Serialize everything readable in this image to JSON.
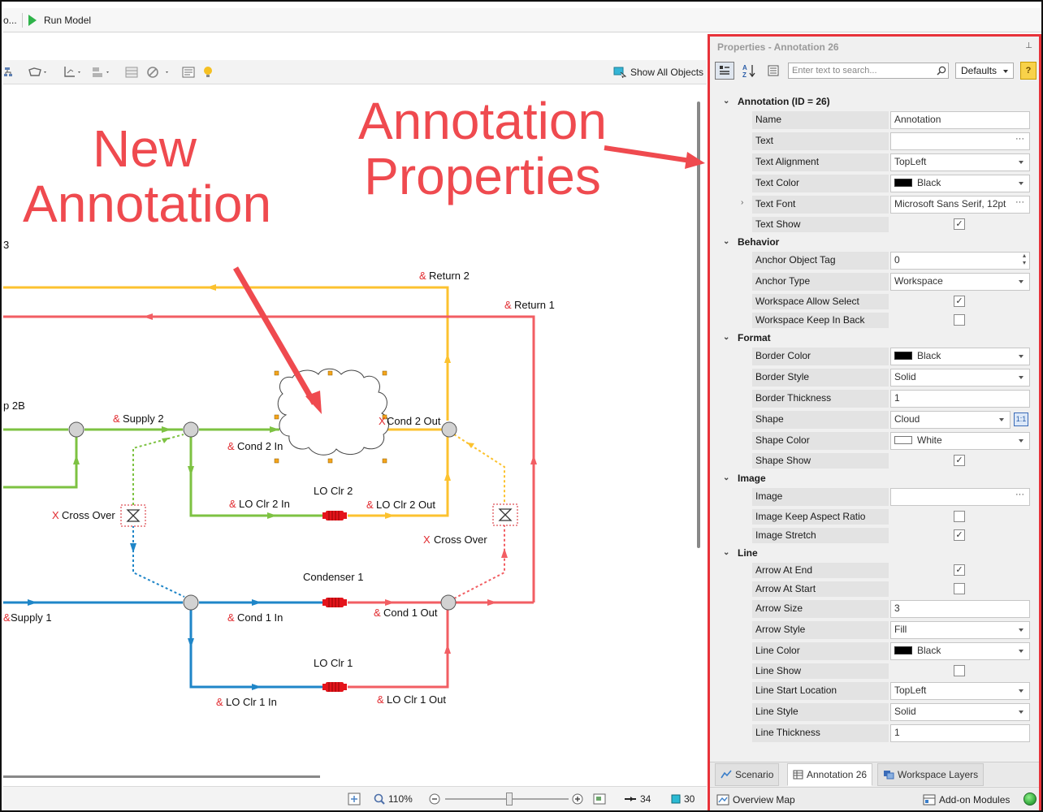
{
  "toolbar": {
    "left_cut_label": "o...",
    "run_model_label": "Run Model",
    "show_all_objects_label": "Show All Objects"
  },
  "callouts": {
    "new_annotation": "New\nAnnotation",
    "annotation_properties": "Annotation\nProperties"
  },
  "workspace_labels": {
    "truncated_3": "3",
    "p2b": "p 2B",
    "return2": "Return 2",
    "return1": "Return 1",
    "supply2": "Supply 2",
    "cond2in": "Cond 2 In",
    "cond2out": "Cond 2 Out",
    "loclr2": "LO Clr 2",
    "loclr2in": "LO Clr 2 In",
    "loclr2out": "LO Clr 2 Out",
    "crossover_left": "Cross Over",
    "crossover_right": "Cross Over",
    "condenser1": "Condenser 1",
    "supply1": "Supply 1",
    "cond1in": "Cond 1 In",
    "cond1out": "Cond 1 Out",
    "loclr1": "LO Clr 1",
    "loclr1in": "LO Clr 1 In",
    "loclr1out": "LO Clr 1 Out",
    "amp": "&",
    "x_mark": "X"
  },
  "status": {
    "zoom": "110%",
    "pipe_count": "34",
    "junction_count": "30"
  },
  "properties": {
    "title": "Properties - Annotation 26",
    "search_placeholder": "Enter text to search...",
    "defaults_label": "Defaults",
    "sections": {
      "annotation": "Annotation (ID = 26)",
      "behavior": "Behavior",
      "format": "Format",
      "image": "Image",
      "line": "Line"
    },
    "rows": {
      "name": {
        "label": "Name",
        "value": "Annotation"
      },
      "text": {
        "label": "Text",
        "value": ""
      },
      "text_alignment": {
        "label": "Text Alignment",
        "value": "TopLeft"
      },
      "text_color": {
        "label": "Text Color",
        "value": "Black"
      },
      "text_font": {
        "label": "Text Font",
        "value": "Microsoft Sans Serif, 12pt"
      },
      "text_show": {
        "label": "Text Show",
        "checked": true
      },
      "anchor_object_tag": {
        "label": "Anchor Object Tag",
        "value": "0"
      },
      "anchor_type": {
        "label": "Anchor Type",
        "value": "Workspace"
      },
      "workspace_allow_select": {
        "label": "Workspace Allow Select",
        "checked": true
      },
      "workspace_keep_in_back": {
        "label": "Workspace Keep In Back",
        "checked": false
      },
      "border_color": {
        "label": "Border Color",
        "value": "Black"
      },
      "border_style": {
        "label": "Border Style",
        "value": "Solid"
      },
      "border_thickness": {
        "label": "Border Thickness",
        "value": "1"
      },
      "shape": {
        "label": "Shape",
        "value": "Cloud",
        "ratio_button": "1:1"
      },
      "shape_color": {
        "label": "Shape Color",
        "value": "White"
      },
      "shape_show": {
        "label": "Shape Show",
        "checked": true
      },
      "image": {
        "label": "Image",
        "value": ""
      },
      "image_keep_aspect_ratio": {
        "label": "Image Keep Aspect Ratio",
        "checked": false
      },
      "image_stretch": {
        "label": "Image Stretch",
        "checked": true
      },
      "arrow_at_end": {
        "label": "Arrow At End",
        "checked": true
      },
      "arrow_at_start": {
        "label": "Arrow At Start",
        "checked": false
      },
      "arrow_size": {
        "label": "Arrow Size",
        "value": "3"
      },
      "arrow_style": {
        "label": "Arrow Style",
        "value": "Fill"
      },
      "line_color": {
        "label": "Line Color",
        "value": "Black"
      },
      "line_show": {
        "label": "Line Show",
        "checked": false
      },
      "line_start_location": {
        "label": "Line Start Location",
        "value": "TopLeft"
      },
      "line_style": {
        "label": "Line Style",
        "value": "Solid"
      },
      "line_thickness": {
        "label": "Line Thickness",
        "value": "1"
      }
    },
    "tabs": {
      "scenario": "Scenario",
      "annotation": "Annotation 26",
      "workspace_layers": "Workspace Layers"
    },
    "bottom": {
      "overview_map": "Overview Map",
      "addon_modules": "Add-on Modules"
    }
  },
  "colors": {
    "callout_red": "#ef4a4f",
    "pipe_green": "#7dc242",
    "pipe_yellow": "#fcc22f",
    "pipe_red": "#f25e63",
    "pipe_blue": "#1f86c8",
    "status_green": "#3cb043"
  }
}
